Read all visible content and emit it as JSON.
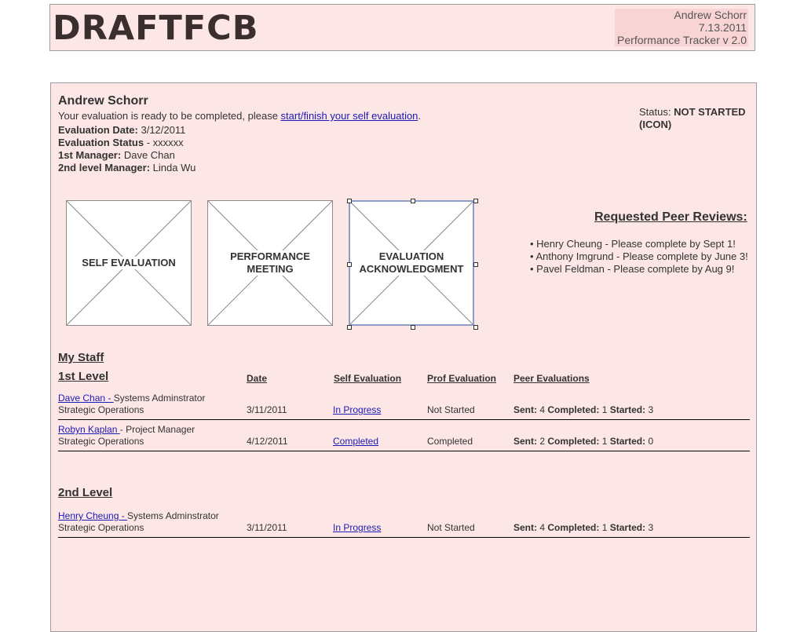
{
  "header": {
    "logo": "DRAFTFCB",
    "user": "Andrew Schorr",
    "date": "7.13.2011",
    "app": "Performance Tracker v 2.0"
  },
  "profile": {
    "name": "Andrew Schorr",
    "notice_prefix": "Your evaluation is ready to be completed, please ",
    "notice_link": "start/finish your self evaluation",
    "notice_suffix": ".",
    "eval_date_label": "Evaluation Date:",
    "eval_date": "3/12/2011",
    "eval_status_label": "Evaluation Status",
    "eval_status": "- xxxxxx",
    "manager1_label": "1st Manager:",
    "manager1": "Dave Chan",
    "manager2_label": "2nd level Manager:",
    "manager2": "Linda Wu"
  },
  "status": {
    "label": "Status:",
    "value": "NOT STARTED",
    "icon_text": "(ICON)"
  },
  "cards": [
    {
      "line1": "SELF EVALUATION",
      "line2": ""
    },
    {
      "line1": "PERFORMANCE",
      "line2": "MEETING"
    },
    {
      "line1": "EVALUATION",
      "line2": "ACKNOWLEDGMENT"
    }
  ],
  "peer_reviews": {
    "title": "Requested Peer Reviews:",
    "items": [
      "• Henry Cheung - Please complete by Sept 1!",
      "• Anthony Imgrund - Please complete by June 3!",
      "• Pavel Feldman - Please complete by Aug 9!"
    ]
  },
  "staff": {
    "title": "My Staff",
    "level1_title": "1st Level",
    "level2_title": "2nd Level",
    "columns": {
      "date": "Date",
      "self": "Self Evaluation",
      "prof": "Prof Evaluation",
      "peer": "Peer Evaluations"
    },
    "peer_labels": {
      "sent": "Sent:",
      "completed": "Completed:",
      "started": "Started:"
    },
    "level1": [
      {
        "name": "Dave Chan - ",
        "role": "Systems Adminstrator",
        "dept": "Strategic Operations",
        "date": "3/11/2011",
        "self": "In Progress",
        "prof": "Not Started",
        "sent": "4",
        "completed": "1",
        "started": "3"
      },
      {
        "name": "Robyn Kaplan ",
        "role": "- Project Manager",
        "dept": "Strategic Operations",
        "date": "4/12/2011",
        "self": "Completed",
        "prof": "Completed",
        "sent": "2",
        "completed": "1",
        "started": "0"
      }
    ],
    "level2": [
      {
        "name": "Henry Cheung - ",
        "role": "Systems Adminstrator",
        "dept": "Strategic Operations",
        "date": "3/11/2011",
        "self": "In Progress",
        "prof": "Not Started",
        "sent": "4",
        "completed": "1",
        "started": "3"
      }
    ]
  }
}
